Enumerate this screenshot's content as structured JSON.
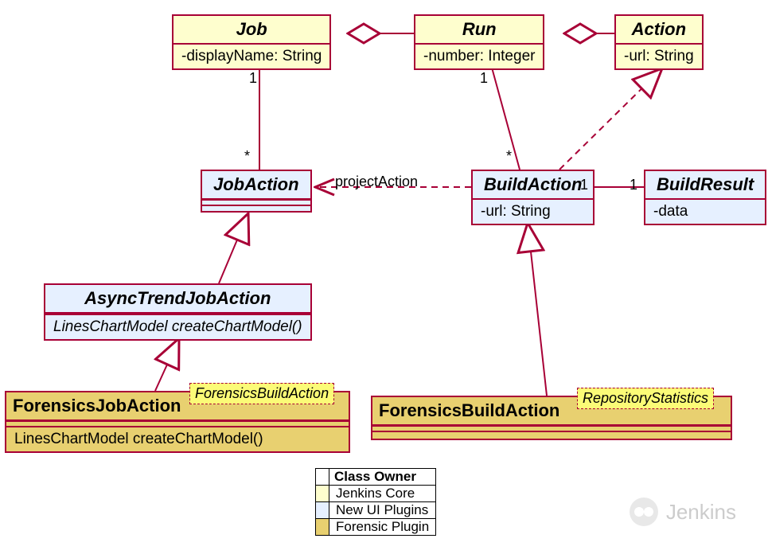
{
  "classes": {
    "job": {
      "name": "Job",
      "attr": "-displayName: String"
    },
    "run": {
      "name": "Run",
      "attr": "-number: Integer"
    },
    "action": {
      "name": "Action",
      "attr": "-url: String"
    },
    "jobaction": {
      "name": "JobAction"
    },
    "buildaction": {
      "name": "BuildAction",
      "attr": "-url: String"
    },
    "buildresult": {
      "name": "BuildResult",
      "attr": "-data"
    },
    "asynctrend": {
      "name": "AsyncTrendJobAction",
      "op": "LinesChartModel createChartModel()"
    },
    "forensicsjob": {
      "name": "ForensicsJobAction",
      "op": "LinesChartModel createChartModel()"
    },
    "forensicsbuild": {
      "name": "ForensicsBuildAction"
    }
  },
  "notes": {
    "fba_note": "ForensicsBuildAction",
    "repostats_note": "RepositoryStatistics"
  },
  "mult": {
    "job_one": "1",
    "job_star": "*",
    "run_one": "1",
    "run_star": "*",
    "ba_one_left": "1",
    "br_one_right": "1"
  },
  "labels": {
    "projectAction": "projectAction"
  },
  "legend": {
    "title": "Class Owner",
    "rows": [
      {
        "color": "#fefece",
        "label": "Jenkins Core"
      },
      {
        "color": "#e6f0ff",
        "label": "New UI Plugins"
      },
      {
        "color": "#e8d070",
        "label": "Forensic Plugin"
      }
    ]
  },
  "watermark": "Jenkins"
}
